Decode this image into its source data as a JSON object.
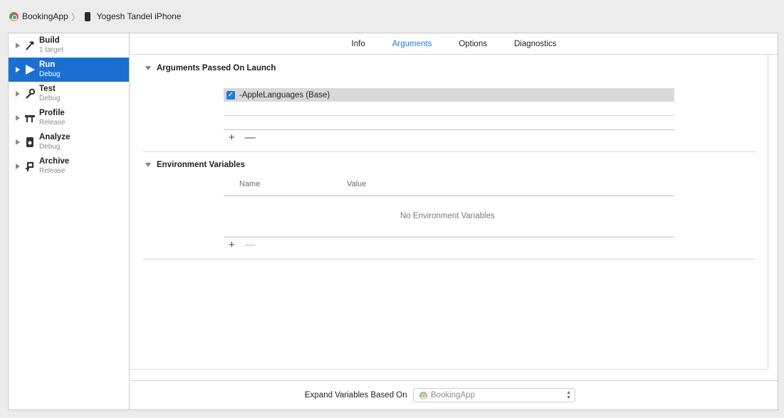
{
  "breadcrumb": {
    "project": "BookingApp",
    "device": "Yogesh Tandel iPhone"
  },
  "sidebar": {
    "items": [
      {
        "title": "Build",
        "sub": "1 target",
        "icon": "hammer-icon",
        "active": false
      },
      {
        "title": "Run",
        "sub": "Debug",
        "icon": "play-icon",
        "active": true
      },
      {
        "title": "Test",
        "sub": "Debug",
        "icon": "wrench-icon",
        "active": false
      },
      {
        "title": "Profile",
        "sub": "Release",
        "icon": "instruments-icon",
        "active": false
      },
      {
        "title": "Analyze",
        "sub": "Debug",
        "icon": "analyze-icon",
        "active": false
      },
      {
        "title": "Archive",
        "sub": "Release",
        "icon": "archive-icon",
        "active": false
      }
    ]
  },
  "tabs": [
    {
      "label": "Info",
      "active": false
    },
    {
      "label": "Arguments",
      "active": true
    },
    {
      "label": "Options",
      "active": false
    },
    {
      "label": "Diagnostics",
      "active": false
    }
  ],
  "arguments": {
    "heading": "Arguments Passed On Launch",
    "items": [
      {
        "value": "-AppleLanguages (Base)",
        "checked": true
      }
    ],
    "add": "+",
    "remove": "—"
  },
  "environment": {
    "heading": "Environment Variables",
    "col_name": "Name",
    "col_value": "Value",
    "empty": "No Environment Variables",
    "add": "+",
    "remove": "—"
  },
  "bottom": {
    "label": "Expand Variables Based On",
    "selected": "BookingApp"
  },
  "colors": {
    "accent": "#1c6fd1",
    "tab_active": "#1f7ed6"
  }
}
